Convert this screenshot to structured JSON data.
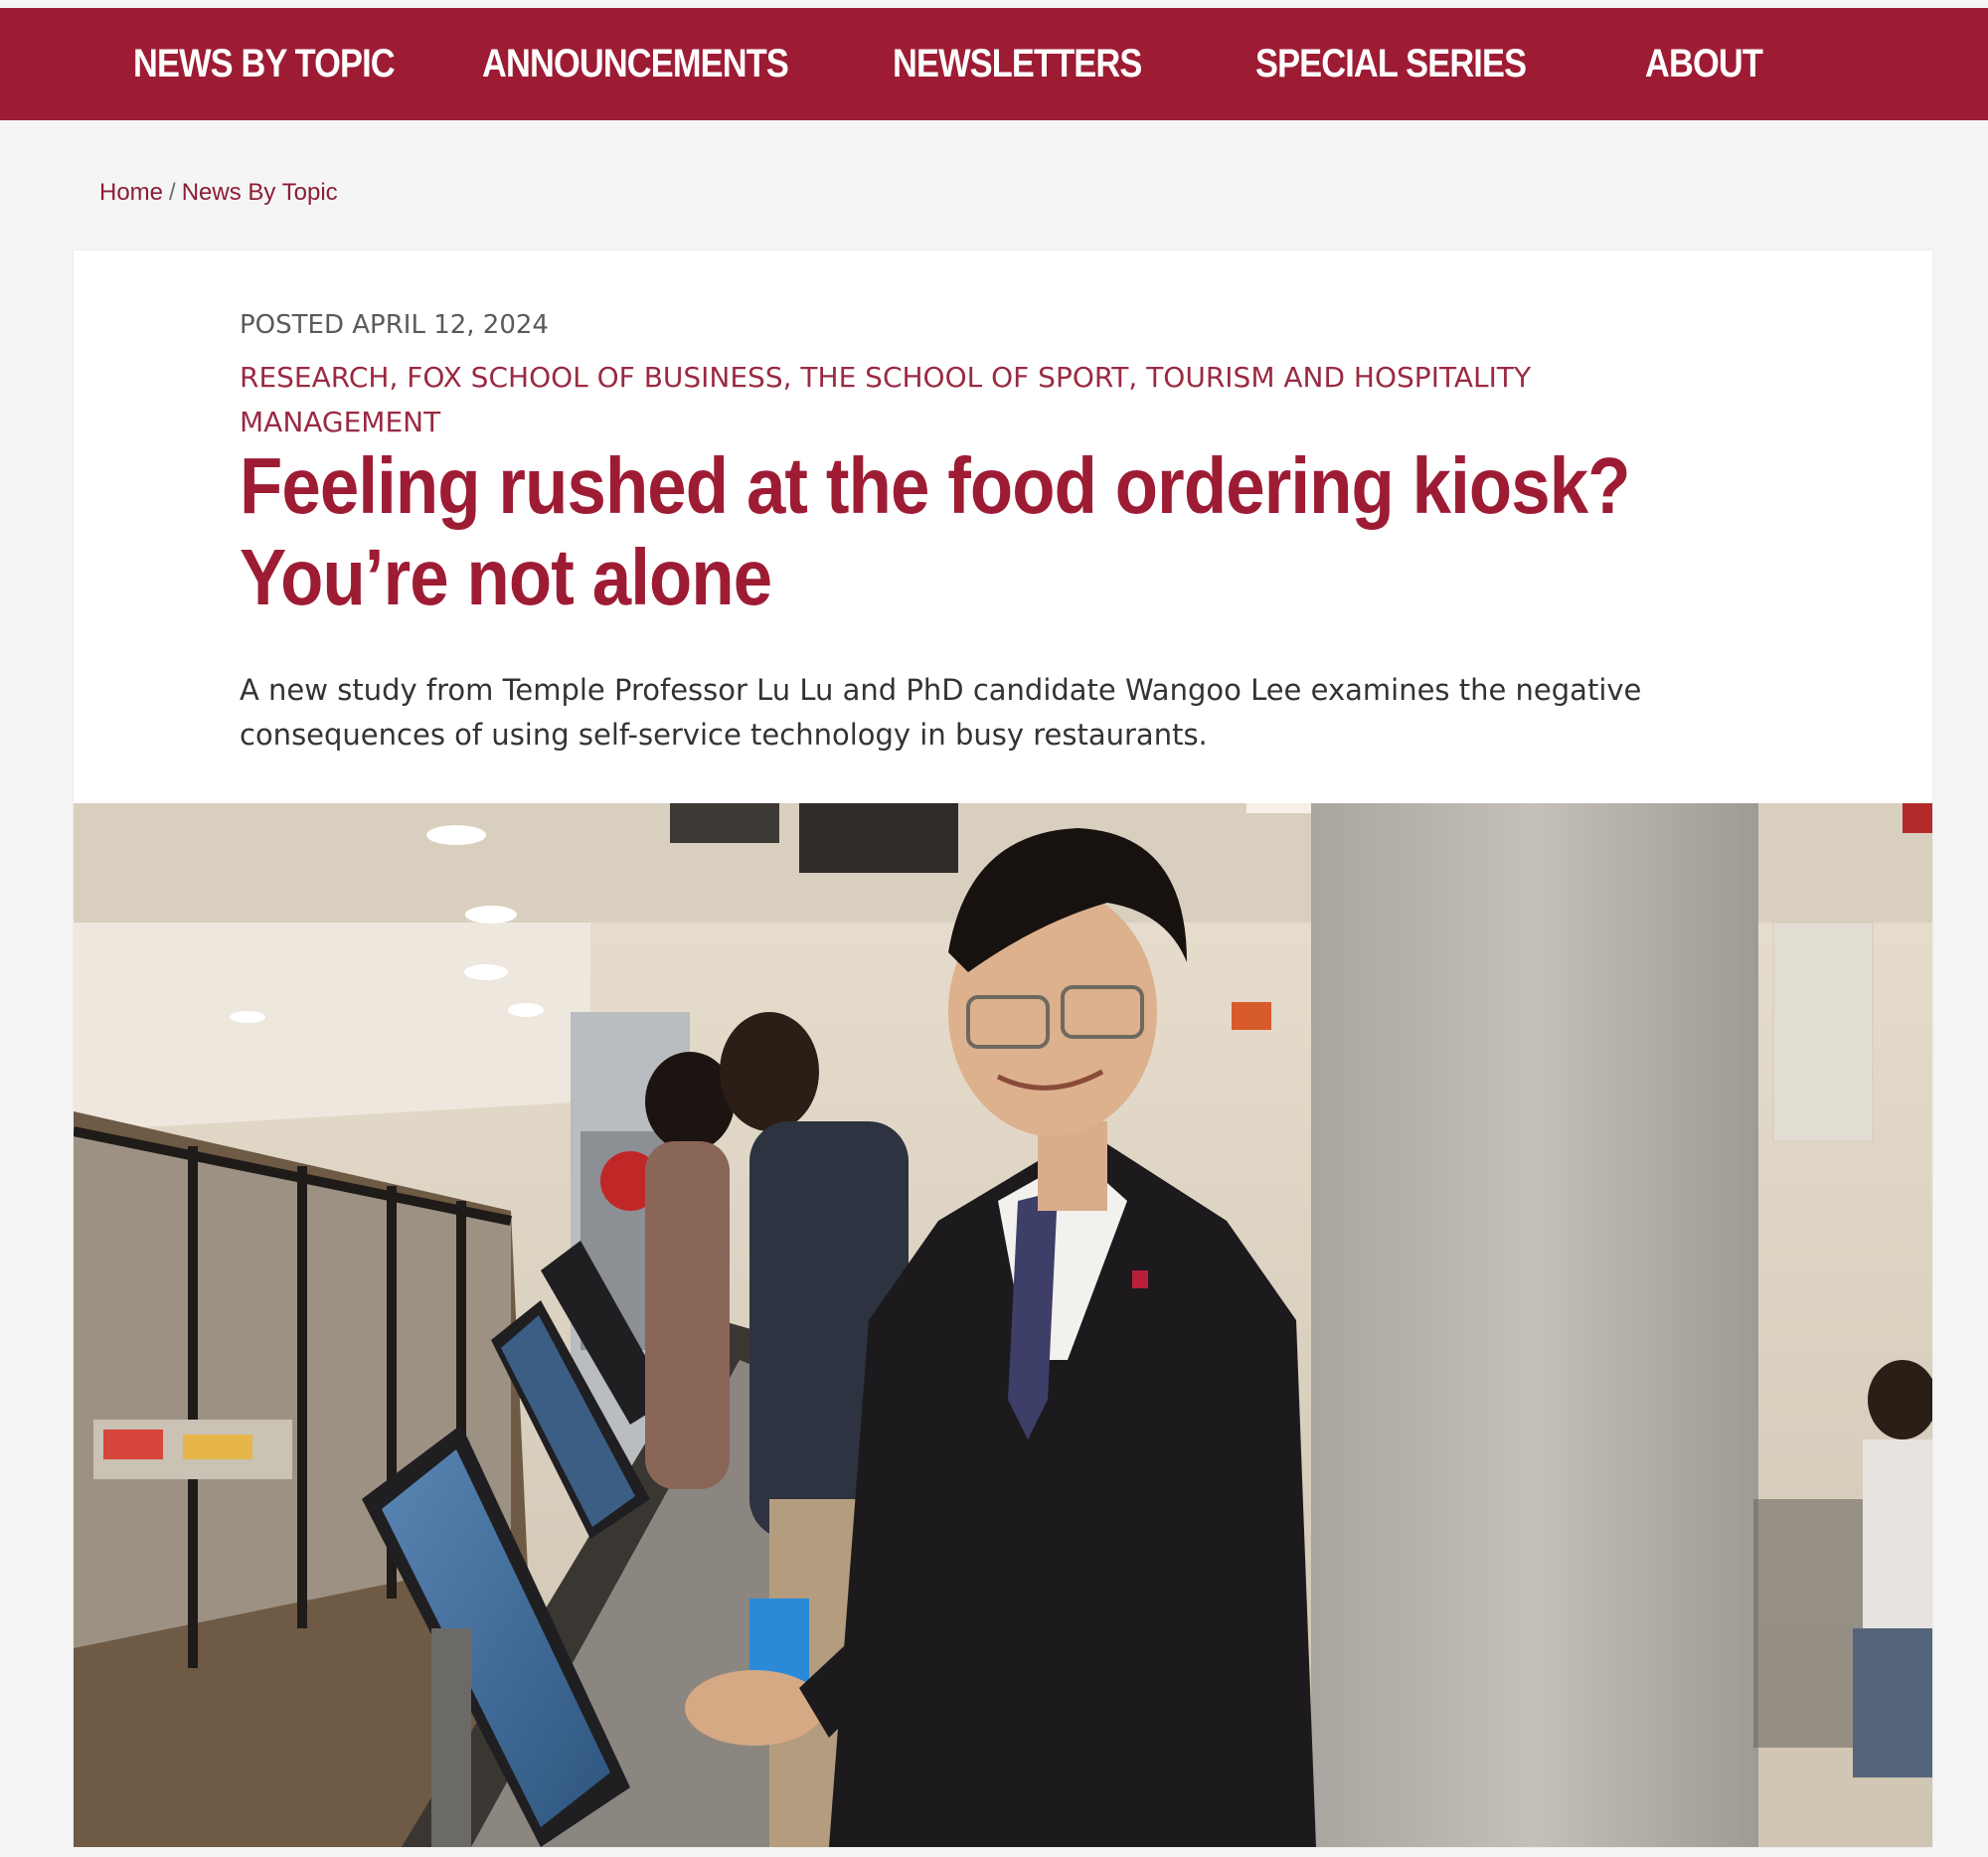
{
  "nav": {
    "items": [
      {
        "label": "NEWS BY TOPIC"
      },
      {
        "label": "ANNOUNCEMENTS"
      },
      {
        "label": "NEWSLETTERS"
      },
      {
        "label": "SPECIAL SERIES"
      },
      {
        "label": "ABOUT"
      }
    ]
  },
  "breadcrumb": {
    "home": "Home",
    "separator": "/",
    "current": "News By Topic"
  },
  "article": {
    "posted": "POSTED APRIL 12, 2024",
    "categories": {
      "research": "RESEARCH",
      "fox": "FOX SCHOOL OF BUSINESS",
      "sthm": "THE SCHOOL OF SPORT, TOURISM AND HOSPITALITY MANAGEMENT"
    },
    "headline": "Feeling rushed at the food ordering kiosk? You’re not alone",
    "subhead": "A new study from Temple Professor Lu Lu and PhD candidate Wangoo Lee examines the negative consequences of using self-service technology in busy restaurants."
  },
  "colors": {
    "brand": "#9d1c34",
    "page_background": "#f5f5f5",
    "card_background": "#ffffff"
  }
}
